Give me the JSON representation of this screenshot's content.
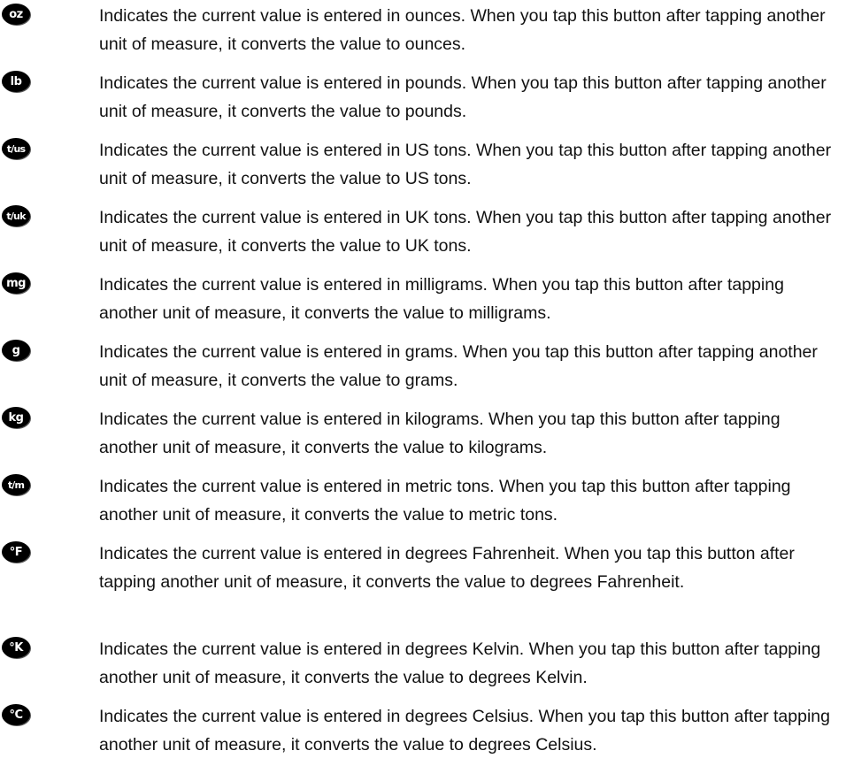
{
  "items": [
    {
      "icon": "oz-button-icon",
      "icon_label": "oz",
      "text": "Indicates the current value is entered in ounces. When you tap this button after tapping another unit of measure, it converts the value to ounces."
    },
    {
      "icon": "lb-button-icon",
      "icon_label": "lb",
      "text": "Indicates the current value is entered in pounds. When you tap this button after tapping another unit of measure, it converts the value to pounds."
    },
    {
      "icon": "us-tons-button-icon",
      "icon_label": "t/us",
      "text": "Indicates the current value is entered in US tons. When you tap this button after tapping another unit of measure, it converts the value to US tons."
    },
    {
      "icon": "uk-tons-button-icon",
      "icon_label": "t/uk",
      "text": "Indicates the current value is entered in UK tons. When you tap this button after tapping another unit of measure, it converts the value to UK tons."
    },
    {
      "icon": "mg-button-icon",
      "icon_label": "mg",
      "text": "Indicates the current value is entered in milligrams. When you tap this button after tapping another unit of measure, it converts the value to milligrams."
    },
    {
      "icon": "g-button-icon",
      "icon_label": "g",
      "text": "Indicates the current value is entered in grams. When you tap this button after tapping another unit of measure, it converts the value to grams."
    },
    {
      "icon": "kg-button-icon",
      "icon_label": "kg",
      "text": "Indicates the current value is entered in kilograms. When you tap this button after tapping another unit of measure, it converts the value to kilograms."
    },
    {
      "icon": "metric-tons-button-icon",
      "icon_label": "t/m",
      "text": "Indicates the current value is entered in metric tons. When you tap this button after tapping another unit of measure, it converts the value to metric tons."
    },
    {
      "icon": "fahrenheit-button-icon",
      "icon_label": "°F",
      "text": "Indicates the current value is entered in degrees Fahrenheit. When you tap this button after tapping another unit of measure, it converts the value to degrees Fahrenheit."
    },
    {
      "icon": "kelvin-button-icon",
      "icon_label": "°K",
      "text": "Indicates the current value is entered in degrees Kelvin. When you tap this button after tapping another unit of measure, it converts the value to degrees Kelvin."
    },
    {
      "icon": "celsius-button-icon",
      "icon_label": "°C",
      "text": "Indicates the current value is entered in degrees Celsius. When you tap this button after tapping another unit of measure, it converts the value to degrees Celsius."
    }
  ]
}
